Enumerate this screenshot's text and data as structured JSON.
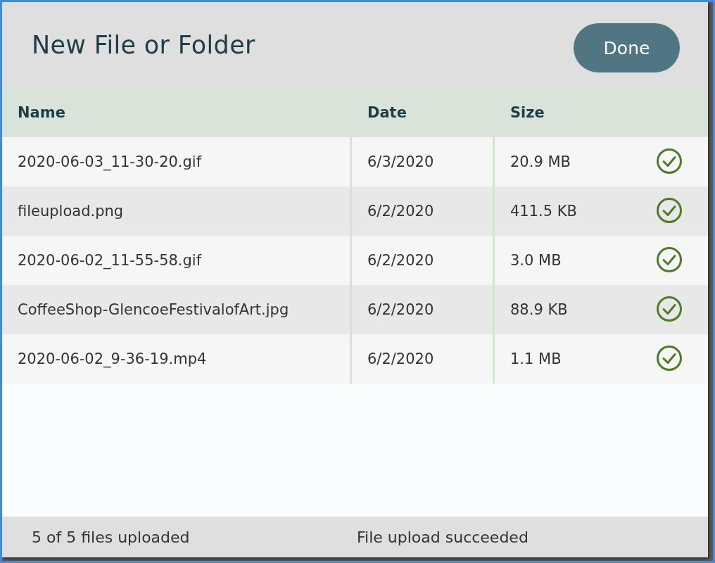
{
  "dialog": {
    "title": "New File or Folder",
    "done_button": "Done"
  },
  "table": {
    "columns": [
      "Name",
      "Date",
      "Size"
    ],
    "rows": [
      {
        "name": "2020-06-03_11-30-20.gif",
        "date": "6/3/2020",
        "size": "20.9 MB",
        "uploaded": true
      },
      {
        "name": "fileupload.png",
        "date": "6/2/2020",
        "size": "411.5 KB",
        "uploaded": true
      },
      {
        "name": "2020-06-02_11-55-58.gif",
        "date": "6/2/2020",
        "size": "3.0 MB",
        "uploaded": true
      },
      {
        "name": "CoffeeShop-GlencoeFestivalofArt.jpg",
        "date": "6/2/2020",
        "size": "88.9 KB",
        "uploaded": true
      },
      {
        "name": "2020-06-02_9-36-19.mp4",
        "date": "6/2/2020",
        "size": "1.1 MB",
        "uploaded": true
      }
    ]
  },
  "status_bar": {
    "count": "5 of 5 files uploaded",
    "message": "File upload succeeded"
  }
}
